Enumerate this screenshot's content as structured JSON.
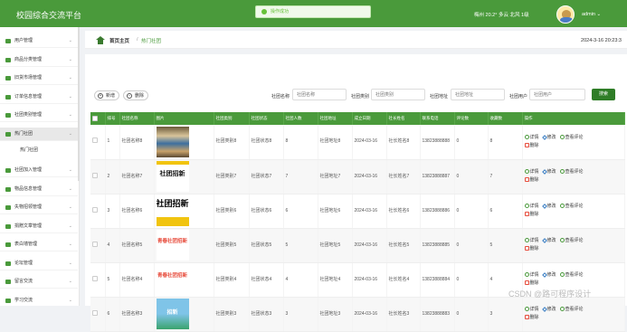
{
  "header": {
    "app_title": "校园综合交流平台",
    "toast_text": "操作成功",
    "weather": "梅州 20.2° 多云 北风 1级",
    "username": "admin",
    "user_chevron": "⌄",
    "colors": {
      "topbar": "#4a9a3b",
      "accent": "#2f7d27",
      "toast_bg": "#f0f9eb"
    }
  },
  "sidebar": {
    "items": [
      {
        "label": "用户管理",
        "icon": "user-icon"
      },
      {
        "label": "商品分类管理",
        "icon": "tag-icon"
      },
      {
        "label": "旧货市场管理",
        "icon": "shop-icon"
      },
      {
        "label": "订单信息管理",
        "icon": "order-icon"
      },
      {
        "label": "社团类别管理",
        "icon": "group-icon"
      },
      {
        "label": "热门社团",
        "icon": "location-icon",
        "active": true
      },
      {
        "label": "社团加入管理",
        "icon": "join-icon"
      },
      {
        "label": "物品信息管理",
        "icon": "box-icon"
      },
      {
        "label": "失物招领管理",
        "icon": "search-icon"
      },
      {
        "label": "捐赠文章管理",
        "icon": "article-icon"
      },
      {
        "label": "表白墙管理",
        "icon": "heart-icon"
      },
      {
        "label": "论坛管理",
        "icon": "forum-icon"
      },
      {
        "label": "留言交流",
        "icon": "message-icon"
      },
      {
        "label": "学习交流",
        "icon": "study-icon"
      }
    ],
    "sub_item": "热门社团",
    "chevron": "⌄"
  },
  "breadcrumb": {
    "home": "首页主页",
    "separator": "/",
    "current": "热门社团",
    "datetime": "2024-3-16 20:23:3"
  },
  "toolbar": {
    "add_label": "新增",
    "add_icon": "+",
    "delete_label": "删除",
    "delete_icon": "−"
  },
  "filters": [
    {
      "label": "社团名称",
      "placeholder": "社团名称"
    },
    {
      "label": "社团类别",
      "placeholder": "社团类别"
    },
    {
      "label": "社团地址",
      "placeholder": "社团地址"
    },
    {
      "label": "社团用户",
      "placeholder": "社团用户"
    }
  ],
  "search_label": "搜索",
  "table": {
    "columns": [
      "",
      "排号",
      "社团名称",
      "图片",
      "社团类别",
      "社团状态",
      "社团人数",
      "社团地址",
      "成立日期",
      "社长姓名",
      "联系电话",
      "评论数",
      "收藏数",
      "操作"
    ],
    "rows": [
      {
        "idx": "1",
        "name": "社团名称8",
        "cat": "社团类别8",
        "status": "社团状态8",
        "count": "8",
        "addr": "社团地址8",
        "date": "2024-03-16",
        "leader": "社长姓名8",
        "phone": "13823888888",
        "comments": "0",
        "favs": "8"
      },
      {
        "idx": "2",
        "name": "社团名称7",
        "cat": "社团类别7",
        "status": "社团状态7",
        "count": "7",
        "addr": "社团地址7",
        "date": "2024-03-16",
        "leader": "社长姓名7",
        "phone": "13823888887",
        "comments": "0",
        "favs": "7"
      },
      {
        "idx": "3",
        "name": "社团名称6",
        "cat": "社团类别6",
        "status": "社团状态6",
        "count": "6",
        "addr": "社团地址6",
        "date": "2024-03-16",
        "leader": "社长姓名6",
        "phone": "13823888886",
        "comments": "0",
        "favs": "6"
      },
      {
        "idx": "4",
        "name": "社团名称5",
        "cat": "社团类别5",
        "status": "社团状态5",
        "count": "5",
        "addr": "社团地址5",
        "date": "2024-03-16",
        "leader": "社长姓名5",
        "phone": "13823888885",
        "comments": "0",
        "favs": "5"
      },
      {
        "idx": "5",
        "name": "社团名称4",
        "cat": "社团类别4",
        "status": "社团状态4",
        "count": "4",
        "addr": "社团地址4",
        "date": "2024-03-16",
        "leader": "社长姓名4",
        "phone": "13823888884",
        "comments": "0",
        "favs": "4"
      },
      {
        "idx": "6",
        "name": "社团名称3",
        "cat": "社团类别3",
        "status": "社团状态3",
        "count": "3",
        "addr": "社团地址3",
        "date": "2024-03-16",
        "leader": "社长姓名3",
        "phone": "13823888883",
        "comments": "0",
        "favs": "3"
      }
    ],
    "actions": {
      "detail": "详情",
      "edit": "修改",
      "comments": "查看评论",
      "delete": "删除"
    },
    "thumb_texts": [
      "",
      "社团招新",
      "社团招新",
      "青春社团招新",
      "青春社团招新",
      "招新"
    ]
  },
  "watermark": "CSDN @路可程序设计"
}
